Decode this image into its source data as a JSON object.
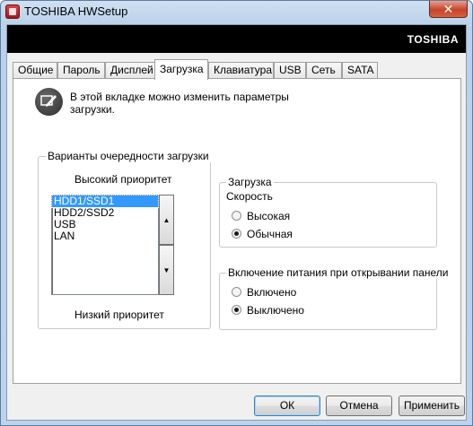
{
  "window": {
    "title": "TOSHIBA HWSetup",
    "close_label": "✕"
  },
  "banner": {
    "brand": "TOSHIBA"
  },
  "tabs": [
    {
      "label": "Общие"
    },
    {
      "label": "Пароль"
    },
    {
      "label": "Дисплей"
    },
    {
      "label": "Загрузка",
      "active": true
    },
    {
      "label": "Клавиатура"
    },
    {
      "label": "USB"
    },
    {
      "label": "Сеть"
    },
    {
      "label": "SATA"
    }
  ],
  "info": {
    "icon": "pen-tablet-icon",
    "text": "В этой вкладке можно изменить параметры загрузки."
  },
  "boot_order": {
    "legend": "Варианты очередности загрузки",
    "high_label": "Высокий приоритет",
    "low_label": "Низкий приоритет",
    "items": [
      "HDD1/SSD1",
      "HDD2/SSD2",
      "USB",
      "LAN"
    ],
    "selected": "HDD1/SSD1",
    "up_glyph": "▲",
    "down_glyph": "▼"
  },
  "boot_speed": {
    "legend": "Загрузка",
    "subtitle": "Скорость",
    "options": [
      "Высокая",
      "Обычная"
    ],
    "selected": "Обычная"
  },
  "power_on_lid": {
    "legend": "Включение питания при открывании панели",
    "options": [
      "Включено",
      "Выключено"
    ],
    "selected": "Выключено"
  },
  "buttons": {
    "ok": "ОК",
    "cancel": "Отмена",
    "apply": "Применить"
  }
}
